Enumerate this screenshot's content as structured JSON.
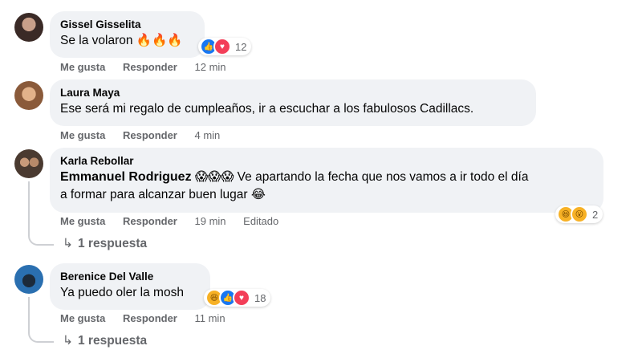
{
  "comments": [
    {
      "author": "Gissel Gisselita",
      "text": "Se la volaron 🔥🔥🔥",
      "like_label": "Me gusta",
      "reply_label": "Responder",
      "time": "12 min",
      "reaction_count": "12",
      "reactions": [
        "like-icon",
        "love-icon"
      ]
    },
    {
      "author": "Laura Maya",
      "text": "Ese será mi regalo de cumpleaños, ir a escuchar a los fabulosos Cadillacs.",
      "like_label": "Me gusta",
      "reply_label": "Responder",
      "time": "4 min"
    },
    {
      "author": "Karla Rebollar",
      "mention": "Emmanuel Rodriguez",
      "text_line1": "😱😱😱 Ve apartando la fecha que nos vamos a ir todo el día",
      "text_line2": "a formar para alcanzar buen lugar 😂",
      "like_label": "Me gusta",
      "reply_label": "Responder",
      "time": "19 min",
      "edited": "Editado",
      "reaction_count": "2",
      "reactions": [
        "haha-icon",
        "wow-icon"
      ],
      "replies": "1 respuesta"
    },
    {
      "author": "Berenice Del Valle",
      "text": "Ya puedo oler la mosh",
      "like_label": "Me gusta",
      "reply_label": "Responder",
      "time": "11 min",
      "reaction_count": "18",
      "reactions": [
        "haha-icon",
        "like-icon",
        "love-icon"
      ],
      "replies": "1 respuesta"
    }
  ],
  "colors": {
    "bubble": "#f0f2f5",
    "secondary_text": "#65676b",
    "like": "#1877f2",
    "love": "#f33e58",
    "haha": "#f7b125"
  }
}
